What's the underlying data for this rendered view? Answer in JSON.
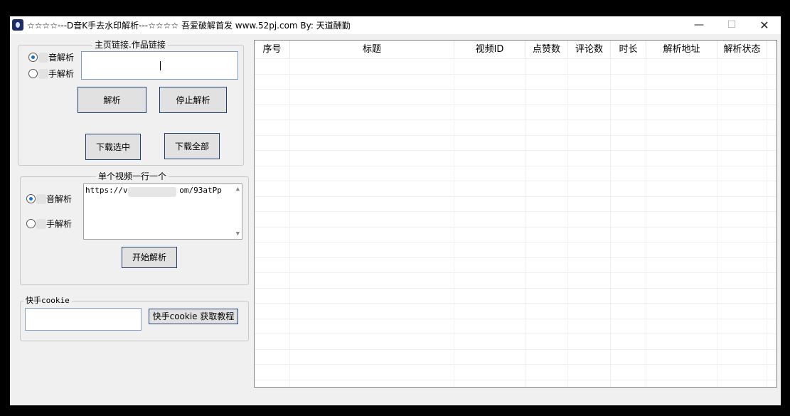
{
  "window": {
    "title": "☆☆☆☆---D音K手去水印解析---☆☆☆☆ 吾爱破解首发  www.52pj.com   By:  天道酬勤",
    "min_glyph": "—",
    "max_glyph": "☐",
    "close_glyph": "✕"
  },
  "home_group": {
    "title": "主页链接.作品链接",
    "radio1_label": "音解析",
    "radio2_label": "手解析",
    "input_value": "",
    "parse_label": "解析",
    "stop_label": "停止解析",
    "download_selected_label": "下载选中",
    "download_all_label": "下载全部"
  },
  "single_group": {
    "title": "单个视频一行一个",
    "radio1_label": "音解析",
    "radio2_label": "手解析",
    "url_start": "https://v.",
    "url_end": "om/93atPp",
    "start_label": "开始解析"
  },
  "cookie_group": {
    "title": "快手cookie",
    "input_value": "",
    "tutorial_label": "快手cookie 获取教程"
  },
  "table": {
    "columns": [
      "序号",
      "标题",
      "视频ID",
      "点赞数",
      "评论数",
      "时长",
      "解析地址",
      "解析状态"
    ],
    "rows": []
  }
}
